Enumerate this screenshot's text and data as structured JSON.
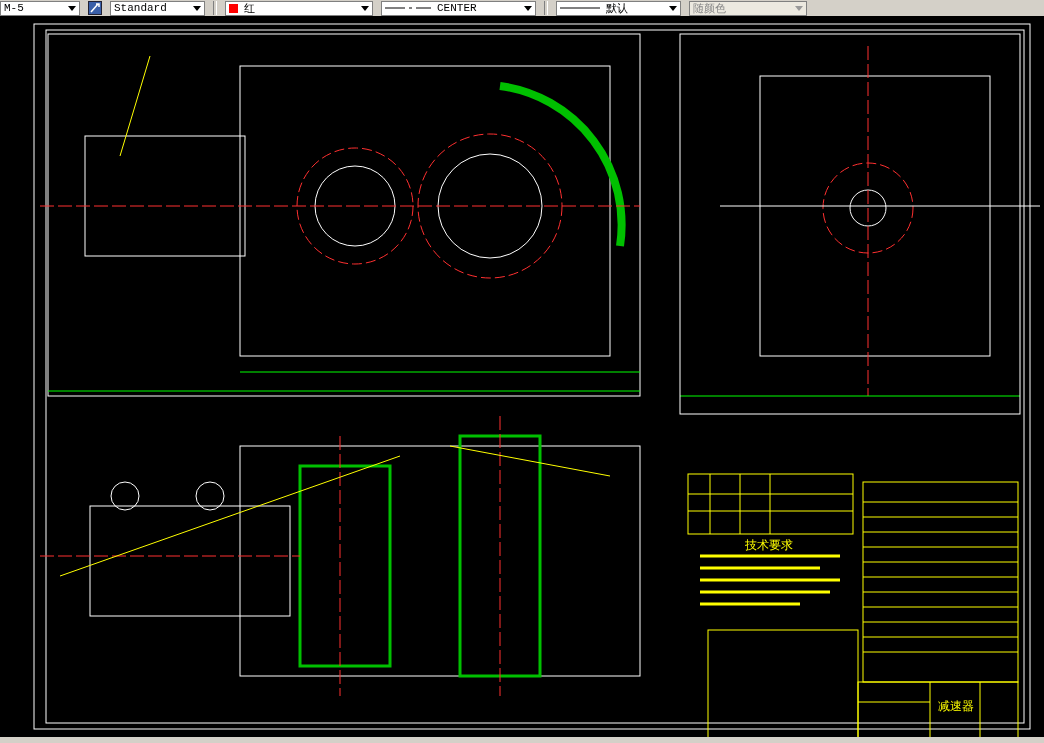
{
  "toolbar": {
    "combos": [
      {
        "kind": "text",
        "value": "M-5",
        "disabled": false
      },
      {
        "kind": "style",
        "value": "Standard",
        "disabled": false
      },
      {
        "kind": "color",
        "value": "红",
        "color": "#ff0000",
        "disabled": false
      },
      {
        "kind": "linetype",
        "value": "CENTER",
        "disabled": false
      },
      {
        "kind": "lineweight",
        "value": "默认",
        "disabled": false
      },
      {
        "kind": "text",
        "value": "随颜色",
        "disabled": true
      }
    ]
  },
  "drawing": {
    "requirements_title": "技术要求",
    "title_block_name": "减速器"
  }
}
